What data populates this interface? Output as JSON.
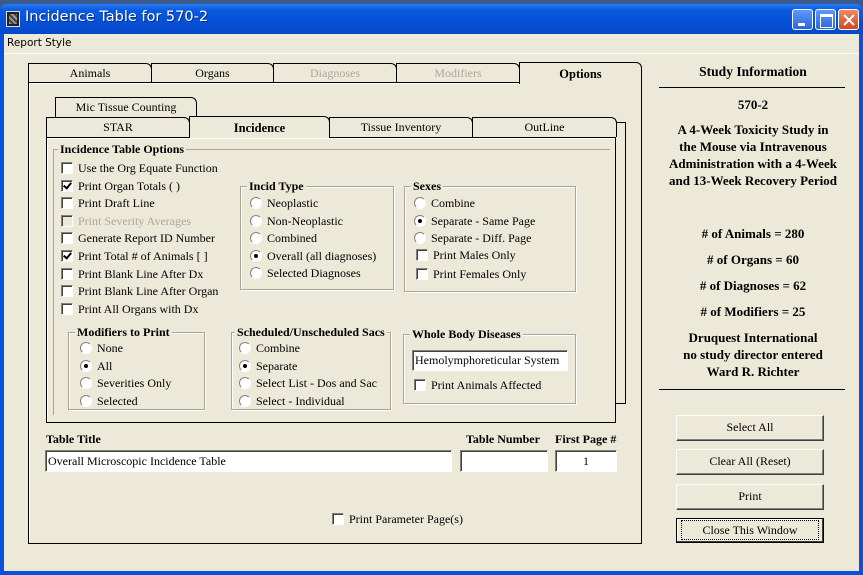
{
  "window": {
    "title": "Incidence Table for 570-2",
    "controls": [
      "minimize",
      "maximize",
      "close"
    ]
  },
  "menubar": {
    "items": [
      "Report Style"
    ]
  },
  "outer_tabs": [
    {
      "label": "Animals",
      "state": "enabled"
    },
    {
      "label": "Organs",
      "state": "enabled"
    },
    {
      "label": "Diagnoses",
      "state": "disabled"
    },
    {
      "label": "Modifiers",
      "state": "disabled"
    },
    {
      "label": "Options",
      "state": "active"
    }
  ],
  "inner_tabs_back": [
    {
      "label": "Mic Tissue Counting"
    }
  ],
  "inner_tabs_front": [
    {
      "label": "STAR"
    },
    {
      "label": "Incidence",
      "active": true
    },
    {
      "label": "Tissue Inventory"
    },
    {
      "label": "OutLine"
    }
  ],
  "incidence_options": {
    "title": "Incidence Table Options",
    "items": [
      {
        "label": "Use the Org Equate Function",
        "checked": false,
        "disabled": false
      },
      {
        "label": "Print Organ Totals ( )",
        "checked": true,
        "disabled": false
      },
      {
        "label": "Print Draft Line",
        "checked": false,
        "disabled": false
      },
      {
        "label": "Print Severity Averages",
        "checked": false,
        "disabled": true
      },
      {
        "label": "Generate Report ID Number",
        "checked": false,
        "disabled": false
      },
      {
        "label": "Print Total # of Animals [ ]",
        "checked": true,
        "disabled": false
      },
      {
        "label": "Print Blank Line After Dx",
        "checked": false,
        "disabled": false
      },
      {
        "label": "Print Blank Line After Organ",
        "checked": false,
        "disabled": false
      },
      {
        "label": "Print All Organs with Dx",
        "checked": false,
        "disabled": false
      }
    ]
  },
  "incid_type": {
    "title": "Incid Type",
    "options": [
      "Neoplastic",
      "Non-Neoplastic",
      "Combined",
      "Overall (all diagnoses)",
      "Selected Diagnoses"
    ],
    "selected": "Overall (all diagnoses)"
  },
  "sexes": {
    "title": "Sexes",
    "options": [
      "Combine",
      "Separate - Same Page",
      "Separate - Diff. Page"
    ],
    "selected": "Separate - Same Page",
    "checkboxes": [
      {
        "label": "Print Males Only",
        "checked": false
      },
      {
        "label": "Print Females Only",
        "checked": false
      }
    ]
  },
  "modifiers_to_print": {
    "title": "Modifiers to Print",
    "options": [
      "None",
      "All",
      "Severities Only",
      "Selected"
    ],
    "selected": "All"
  },
  "sacs": {
    "title": "Scheduled/Unscheduled Sacs",
    "options": [
      "Combine",
      "Separate",
      "Select List - Dos and Sac",
      "Select - Individual"
    ],
    "selected": "Separate"
  },
  "whole_body": {
    "title": "Whole Body Diseases",
    "value": "Hemolymphoreticular System",
    "checkbox": {
      "label": "Print Animals Affected",
      "checked": false
    }
  },
  "table_fields": {
    "title_label": "Table Title",
    "title_value": "Overall Microscopic Incidence Table",
    "number_label": "Table Number",
    "number_value": "",
    "first_page_label": "First Page #",
    "first_page_value": "1"
  },
  "print_parameter": {
    "label": "Print Parameter Page(s)",
    "checked": false
  },
  "study_info": {
    "heading": "Study Information",
    "study_id": "570-2",
    "description": [
      "A 4-Week Toxicity Study in",
      "the Mouse via Intravenous",
      "Administration with a 4-Week",
      "and 13-Week Recovery Period"
    ],
    "counts": [
      "# of Animals = 280",
      "# of Organs = 60",
      "# of Diagnoses = 62",
      "# of Modifiers = 25"
    ],
    "sponsor": [
      "Druquest International",
      "no study director entered",
      "Ward R. Richter"
    ]
  },
  "buttons": {
    "select_all": "Select All",
    "clear_all": "Clear All (Reset)",
    "print": "Print",
    "close": "Close This Window"
  }
}
